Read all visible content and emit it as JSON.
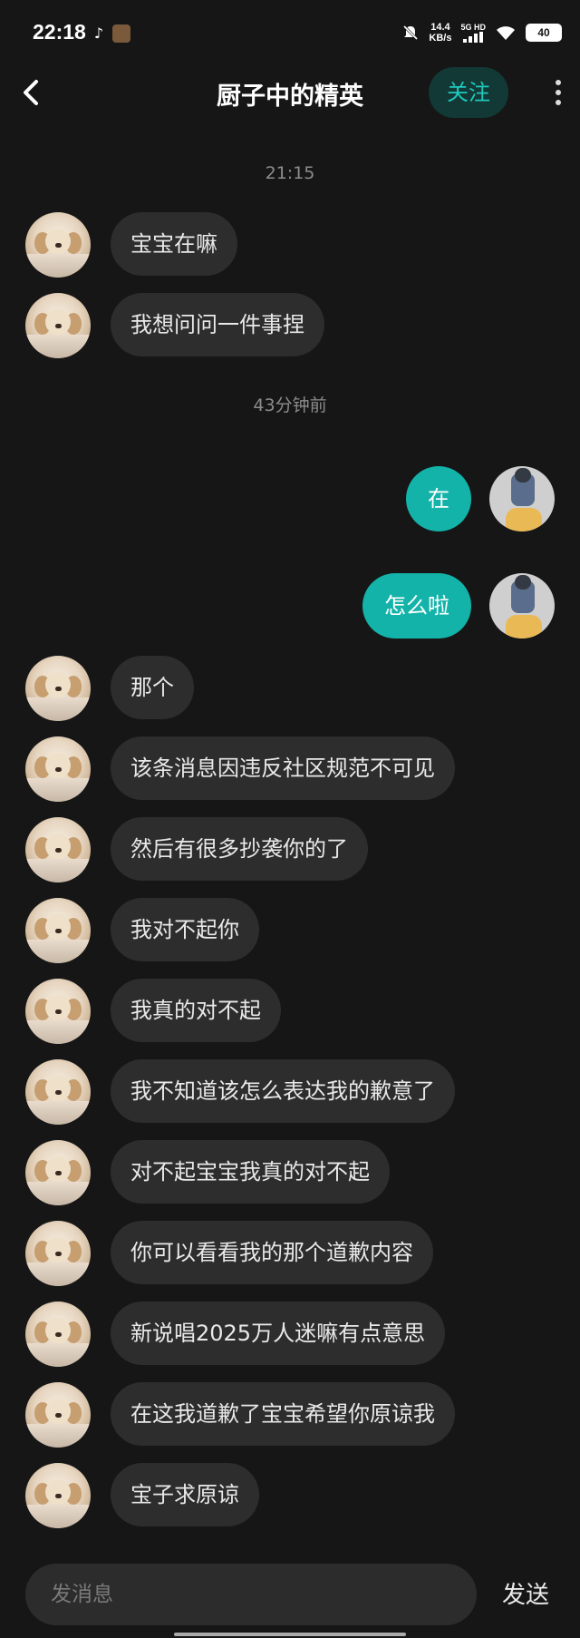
{
  "status_bar": {
    "time": "22:18",
    "net_speed_value": "14.4",
    "net_speed_unit": "KB/s",
    "net_type": "5G HD",
    "battery": "40"
  },
  "header": {
    "title": "厨子中的精英",
    "follow_label": "关注"
  },
  "timestamps": [
    "21:15",
    "43分钟前"
  ],
  "messages": [
    {
      "side": "left",
      "text": "宝宝在嘛"
    },
    {
      "side": "left",
      "text": "我想问问一件事捏"
    },
    {
      "side": "right",
      "text": "在"
    },
    {
      "side": "right",
      "text": "怎么啦"
    },
    {
      "side": "left",
      "text": "那个"
    },
    {
      "side": "left",
      "text": "该条消息因违反社区规范不可见"
    },
    {
      "side": "left",
      "text": "然后有很多抄袭你的了"
    },
    {
      "side": "left",
      "text": "我对不起你"
    },
    {
      "side": "left",
      "text": "我真的对不起"
    },
    {
      "side": "left",
      "text": "我不知道该怎么表达我的歉意了"
    },
    {
      "side": "left",
      "text": "对不起宝宝我真的对不起"
    },
    {
      "side": "left",
      "text": "你可以看看我的那个道歉内容"
    },
    {
      "side": "left",
      "text": "新说唱2025万人迷嘛有点意思"
    },
    {
      "side": "left",
      "text": "在这我道歉了宝宝希望你原谅我"
    },
    {
      "side": "left",
      "text": "宝子求原谅"
    }
  ],
  "composer": {
    "placeholder": "发消息",
    "send_label": "发送"
  },
  "colors": {
    "background": "#161616",
    "incoming_bubble": "#2d2d2d",
    "outgoing_bubble": "#13b3a9",
    "accent": "#1ec9bd"
  },
  "icons": [
    "back-chevron-icon",
    "more-vertical-icon",
    "tiktok-icon",
    "mute-icon",
    "wifi-icon",
    "signal-icon",
    "battery-icon"
  ]
}
